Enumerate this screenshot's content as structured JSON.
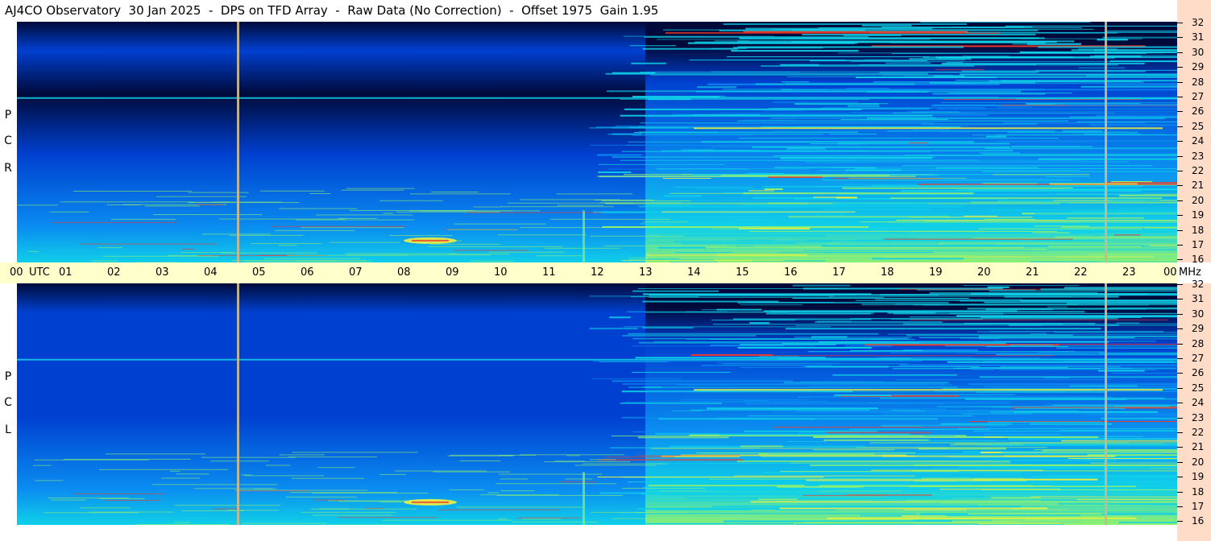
{
  "title": "AJ4CO Observatory  30 Jan 2025  -  DPS on TFD Array  -  Raw Data (No Correction)  -  Offset 1975  Gain 1.95",
  "panels": [
    {
      "name": "RCP",
      "letters": [
        "R",
        "C",
        "P"
      ]
    },
    {
      "name": "LCP",
      "letters": [
        "L",
        "C",
        "P"
      ]
    }
  ],
  "time_axis": {
    "labels": [
      "00",
      "01",
      "02",
      "03",
      "04",
      "05",
      "06",
      "07",
      "08",
      "09",
      "10",
      "11",
      "12",
      "13",
      "14",
      "15",
      "16",
      "17",
      "18",
      "19",
      "20",
      "21",
      "22",
      "23",
      "00"
    ],
    "unit_label": "UTC"
  },
  "freq_axis": {
    "labels": [
      "32",
      "31",
      "30",
      "29",
      "28",
      "27",
      "26",
      "25",
      "24",
      "23",
      "22",
      "21",
      "20",
      "19",
      "18",
      "17",
      "16"
    ],
    "unit_label": "MHz"
  },
  "colors": {
    "background_deep": "#000a3a",
    "background_mid": "#0040d0",
    "background_bright": "#0a8cf0",
    "signal_cyan": "#10d0e8",
    "signal_green": "#90f070",
    "signal_yellow": "#f0f040",
    "signal_red": "#f03a28",
    "time_axis_bg": "#ffffcc",
    "freq_axis_bg": "#ffdcc8"
  },
  "chart_data": {
    "type": "heatmap",
    "title": "AJ4CO Observatory  30 Jan 2025  -  DPS on TFD Array  -  Raw Data (No Correction)  -  Offset 1975  Gain 1.95",
    "x": {
      "label": "UTC",
      "range": [
        "00",
        "00"
      ],
      "ticks": [
        "00",
        "01",
        "02",
        "03",
        "04",
        "05",
        "06",
        "07",
        "08",
        "09",
        "10",
        "11",
        "12",
        "13",
        "14",
        "15",
        "16",
        "17",
        "18",
        "19",
        "20",
        "21",
        "22",
        "23",
        "00"
      ]
    },
    "y": {
      "label": "MHz",
      "range": [
        16,
        32
      ],
      "ticks": [
        32,
        31,
        30,
        29,
        28,
        27,
        26,
        25,
        24,
        23,
        22,
        21,
        20,
        19,
        18,
        17,
        16
      ]
    },
    "series": [
      {
        "name": "RCP",
        "description": "spectrogram"
      },
      {
        "name": "LCP",
        "description": "spectrogram"
      }
    ],
    "features": {
      "sunrise_transition_utc": 13.0,
      "vertical_marker_utc": [
        4.55,
        22.5
      ],
      "strong_band_mhz": [
        27.0,
        25.0
      ],
      "bright_burst_utc": [
        8.0,
        9.1
      ],
      "bright_burst_mhz": 17.5
    }
  }
}
